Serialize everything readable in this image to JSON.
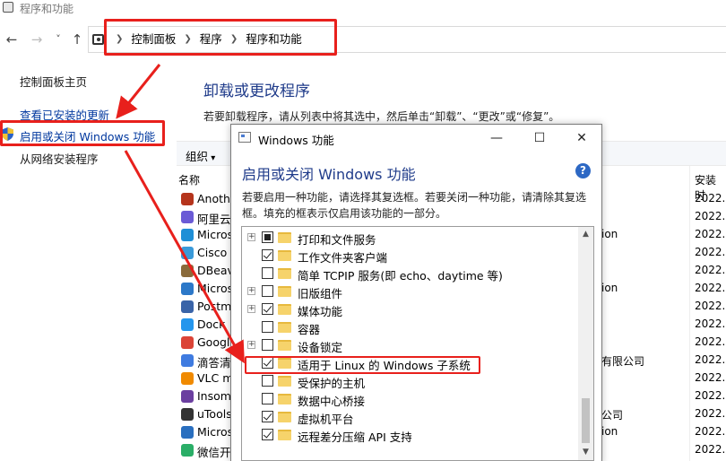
{
  "window_title": "程序和功能",
  "nav": {
    "back": "←",
    "forward": "→",
    "recent": "˅",
    "up": "↑"
  },
  "breadcrumb": [
    "控制面板",
    "程序",
    "程序和功能"
  ],
  "left_nav": {
    "home": "控制面板主页",
    "updates": "查看已安装的更新",
    "windows_features": "启用或关闭 Windows 功能",
    "network_install": "从网络安装程序"
  },
  "main": {
    "title": "卸载或更改程序",
    "description": "若要卸载程序，请从列表中将其选中，然后单击“卸载”、“更改”或“修复”。",
    "organize": "组织",
    "col_name": "名称",
    "col_date": "安装时"
  },
  "programs": [
    {
      "name": "Anothe",
      "publisher": "",
      "date": "2022.0",
      "color": "#b5341c"
    },
    {
      "name": "阿里云",
      "publisher": "",
      "date": "2022.0",
      "color": "#6b5bd6"
    },
    {
      "name": "Micros",
      "publisher": "ion",
      "date": "2022.0",
      "color": "#1f8fd6"
    },
    {
      "name": "Cisco A",
      "publisher": "",
      "date": "2022.0",
      "color": "#3a9ad9"
    },
    {
      "name": "DBeav",
      "publisher": "",
      "date": "2022.0",
      "color": "#8a6a3a"
    },
    {
      "name": "Micros",
      "publisher": "ion",
      "date": "2022.0",
      "color": "#2c78c8"
    },
    {
      "name": "Postma",
      "publisher": "",
      "date": "2022.0",
      "color": "#3a64a8"
    },
    {
      "name": "Dock",
      "publisher": "",
      "date": "2022.0",
      "color": "#2496ed"
    },
    {
      "name": "Googl",
      "publisher": "",
      "date": "2022.0",
      "color": "#db4437"
    },
    {
      "name": "滴答清",
      "publisher": "有限公司",
      "date": "2022.0",
      "color": "#3f7be0"
    },
    {
      "name": "VLC m",
      "publisher": "",
      "date": "2022.0",
      "color": "#f08a00"
    },
    {
      "name": "Insomn",
      "publisher": "",
      "date": "2022.0",
      "color": "#6b3fa0"
    },
    {
      "name": "uTools",
      "publisher": "公司",
      "date": "2022.0",
      "color": "#333333"
    },
    {
      "name": "Micros",
      "publisher": "ion",
      "date": "2022.0",
      "color": "#2a6fbf"
    },
    {
      "name": "微信开",
      "publisher": "",
      "date": "2022.0",
      "color": "#2aae67"
    }
  ],
  "dialog": {
    "title": "Windows 功能",
    "heading": "启用或关闭 Windows 功能",
    "help": "?",
    "description": "若要启用一种功能，请选择其复选框。若要关闭一种功能，请清除其复选框。填充的框表示仅启用该功能的一部分。",
    "controls": {
      "minimize": "—",
      "maximize": "☐",
      "close": "✕"
    },
    "features": [
      {
        "label": "打印和文件服务",
        "state": "partial",
        "expandable": true
      },
      {
        "label": "工作文件夹客户端",
        "state": "checked",
        "expandable": false
      },
      {
        "label": "简单 TCPIP 服务(即 echo、daytime 等)",
        "state": "unchecked",
        "expandable": false
      },
      {
        "label": "旧版组件",
        "state": "unchecked",
        "expandable": true
      },
      {
        "label": "媒体功能",
        "state": "checked",
        "expandable": true
      },
      {
        "label": "容器",
        "state": "unchecked",
        "expandable": false
      },
      {
        "label": "设备锁定",
        "state": "unchecked",
        "expandable": true
      },
      {
        "label": "适用于 Linux 的 Windows 子系统",
        "state": "checked",
        "expandable": false
      },
      {
        "label": "受保护的主机",
        "state": "unchecked",
        "expandable": false
      },
      {
        "label": "数据中心桥接",
        "state": "unchecked",
        "expandable": false
      },
      {
        "label": "虚拟机平台",
        "state": "checked",
        "expandable": false
      },
      {
        "label": "远程差分压缩 API 支持",
        "state": "checked",
        "expandable": false
      }
    ],
    "scroll_up": "▲",
    "scroll_down": "▼"
  },
  "annotation_color": "#e8201c"
}
